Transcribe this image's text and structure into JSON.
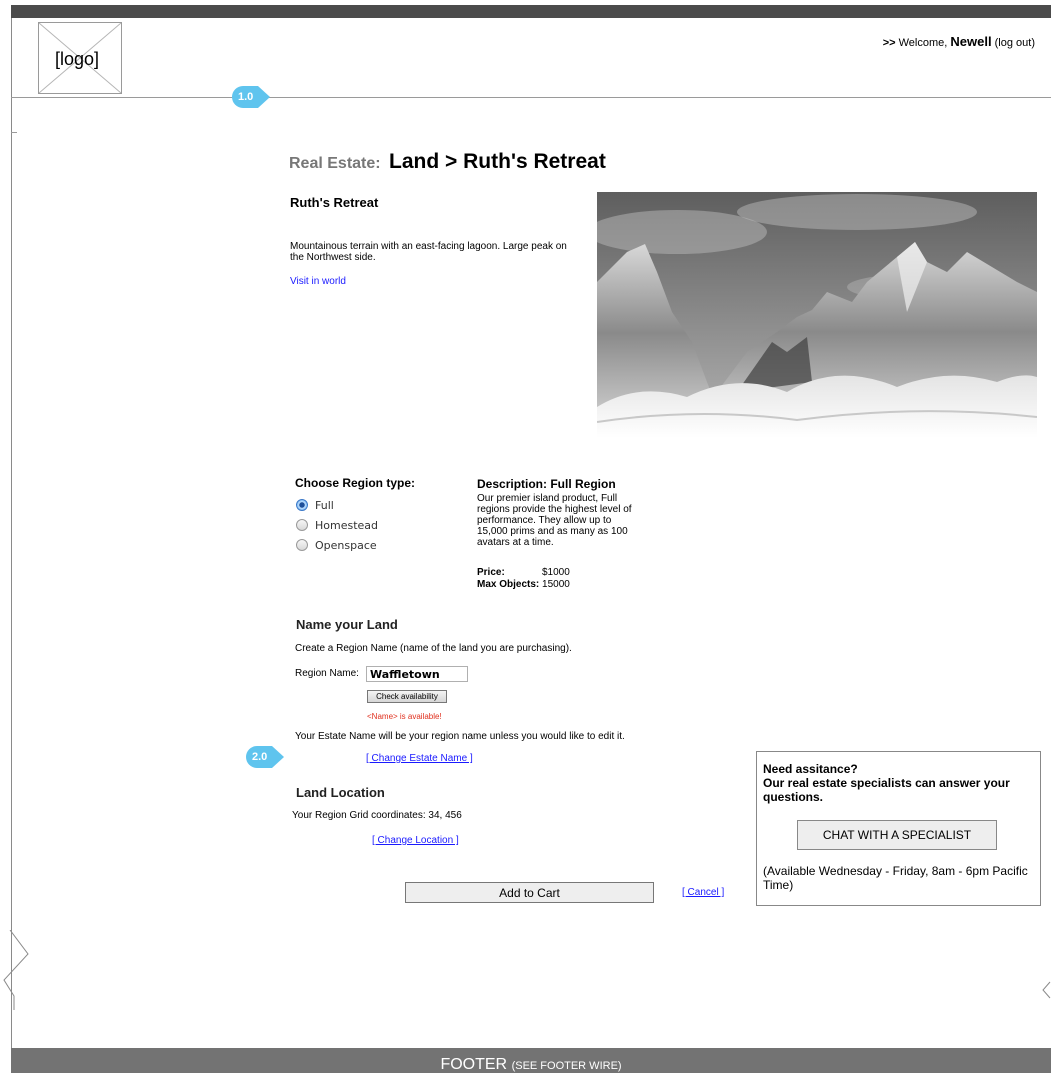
{
  "header": {
    "logo_label": "[logo]",
    "welcome_prefix": ">>",
    "welcome_text": "Welcome,",
    "user_name": "Newell",
    "logout": "(log out)"
  },
  "markers": {
    "m1": "1.0",
    "m2": "2.0"
  },
  "page": {
    "breadcrumb_prefix": "Real Estate:",
    "title": "Land > Ruth's Retreat"
  },
  "property": {
    "name": "Ruth's Retreat",
    "description": "Mountainous terrain with an east-facing lagoon. Large peak on the Northwest side.",
    "visit_link": "Visit in world"
  },
  "region_type": {
    "heading": "Choose Region type:",
    "options": [
      "Full",
      "Homestead",
      "Openspace"
    ],
    "selected": "Full"
  },
  "region_description": {
    "heading": "Description: Full Region",
    "body": "Our premier island product, Full regions provide the highest level of performance. They allow up to 15,000 prims and as many as 100 avatars at a time.",
    "price_label": "Price:",
    "price_value": "$1000",
    "max_label": "Max Objects:",
    "max_value": "15000"
  },
  "name_land": {
    "heading": "Name your Land",
    "instruction": "Create a Region Name (name of the land you are purchasing).",
    "field_label": "Region Name:",
    "field_value": "Waffletown",
    "check_button": "Check availability",
    "availability_msg": "<Name> is available!",
    "estate_note": "Your Estate Name will be your region name unless you would like to edit it.",
    "change_estate": "[ Change Estate Name ]"
  },
  "land_location": {
    "heading": "Land Location",
    "coords_label": "Your Region Grid coordinates:",
    "coords_value": "34, 456",
    "change_location": "[ Change Location ]"
  },
  "actions": {
    "add_to_cart": "Add to Cart",
    "cancel": "[ Cancel ]"
  },
  "help": {
    "title": "Need assitance?\nOur real estate specialists can answer your questions.",
    "chat_button": "CHAT WITH A SPECIALIST",
    "availability": "(Available Wednesday - Friday, 8am - 6pm Pacific Time)"
  },
  "footer": {
    "label": "FOOTER",
    "sub": "(SEE FOOTER WIRE)"
  },
  "colors": {
    "marker": "#5fc4ee",
    "link": "#1a1aff",
    "error": "#e0301e",
    "topbar": "#4b4b4b",
    "footer": "#737373"
  }
}
